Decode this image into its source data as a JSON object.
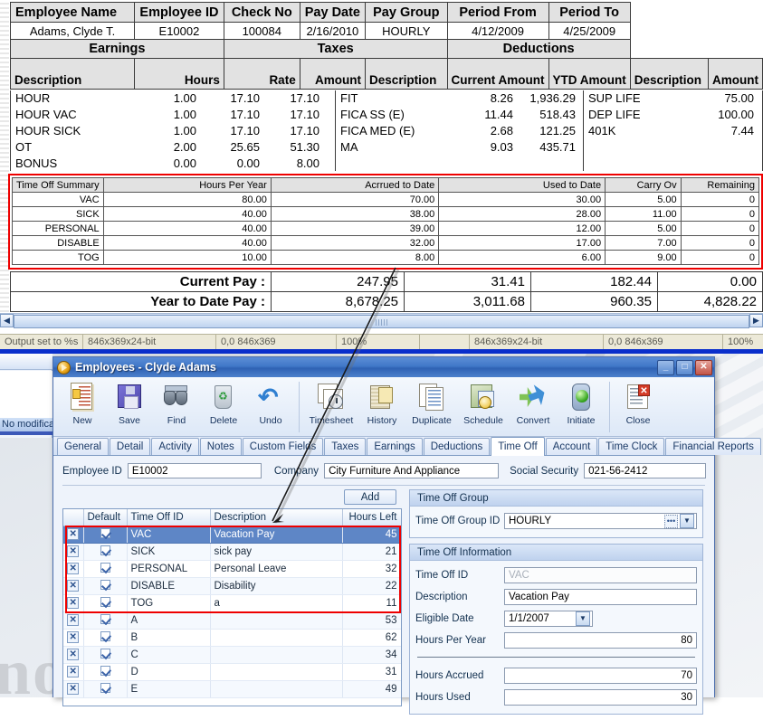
{
  "paystub": {
    "top_headers": [
      "Employee Name",
      "Employee ID",
      "Check No",
      "Pay Date",
      "Pay Group",
      "Period From",
      "Period To"
    ],
    "top_values": [
      "Adams, Clyde T.",
      "E10002",
      "100084",
      "2/16/2010",
      "HOURLY",
      "4/12/2009",
      "4/25/2009"
    ],
    "group_headers": [
      "Earnings",
      "Taxes",
      "Deductions"
    ],
    "earnings_headers": [
      "Description",
      "Hours",
      "Rate",
      "Amount"
    ],
    "taxes_headers": [
      "Description",
      "Current Amount",
      "YTD Amount"
    ],
    "deductions_headers": [
      "Description",
      "Amount"
    ],
    "earnings_rows": [
      {
        "description": "HOUR",
        "hours": "1.00",
        "rate": "17.10",
        "amount": "17.10"
      },
      {
        "description": "HOUR VAC",
        "hours": "1.00",
        "rate": "17.10",
        "amount": "17.10"
      },
      {
        "description": "HOUR SICK",
        "hours": "1.00",
        "rate": "17.10",
        "amount": "17.10"
      },
      {
        "description": "OT",
        "hours": "2.00",
        "rate": "25.65",
        "amount": "51.30"
      },
      {
        "description": "BONUS",
        "hours": "0.00",
        "rate": "0.00",
        "amount": "8.00"
      }
    ],
    "taxes_rows": [
      {
        "description": "FIT",
        "current": "8.26",
        "ytd": "1,936.29"
      },
      {
        "description": "FICA SS (E)",
        "current": "11.44",
        "ytd": "518.43"
      },
      {
        "description": "FICA MED (E)",
        "current": "2.68",
        "ytd": "121.25"
      },
      {
        "description": "MA",
        "current": "9.03",
        "ytd": "435.71"
      }
    ],
    "deductions_rows": [
      {
        "description": "SUP LIFE",
        "amount": "75.00"
      },
      {
        "description": "DEP LIFE",
        "amount": "100.00"
      },
      {
        "description": "401K",
        "amount": "7.44"
      }
    ],
    "time_off_summary": {
      "headers": [
        "Time Off Summary",
        "Hours Per Year",
        "Acrrued to Date",
        "Used to Date",
        "Carry Ov",
        "Remaining"
      ],
      "rows": [
        [
          "VAC",
          "80.00",
          "70.00",
          "30.00",
          "5.00",
          "0"
        ],
        [
          "SICK",
          "40.00",
          "38.00",
          "28.00",
          "11.00",
          "0"
        ],
        [
          "PERSONAL",
          "40.00",
          "39.00",
          "12.00",
          "5.00",
          "0"
        ],
        [
          "DISABLE",
          "40.00",
          "32.00",
          "17.00",
          "7.00",
          "0"
        ],
        [
          "TOG",
          "10.00",
          "8.00",
          "6.00",
          "9.00",
          "0"
        ]
      ]
    },
    "totals": [
      {
        "label": "Current Pay :",
        "c1": "247.95",
        "c2": "31.41",
        "c3": "182.44",
        "c4": "0.00"
      },
      {
        "label": "Year to Date Pay :",
        "c1": "8,678.25",
        "c2": "3,011.68",
        "c3": "960.35",
        "c4": "4,828.22"
      }
    ]
  },
  "statusbar": {
    "cells": [
      "Output set to %s",
      "846x369x24-bit",
      "0,0  846x369",
      "100%",
      "",
      "846x369x24-bit",
      "0,0  846x369",
      "100%"
    ]
  },
  "background": {
    "fragment_text": "No modifica"
  },
  "window": {
    "title": "Employees  -  Clyde Adams",
    "buttons": {
      "minimize": "_",
      "maximize": "□",
      "close": "✕"
    },
    "toolbar": [
      {
        "label": "New",
        "icon": "new-record-icon"
      },
      {
        "label": "Save",
        "icon": "save-floppy-icon"
      },
      {
        "label": "Find",
        "icon": "find-binoculars-icon"
      },
      {
        "label": "Delete",
        "icon": "delete-recycle-icon"
      },
      {
        "label": "Undo",
        "icon": "undo-arrow-icon"
      },
      {
        "label": "Timesheet",
        "icon": "timesheet-clock-icon"
      },
      {
        "label": "History",
        "icon": "history-hourglass-icon"
      },
      {
        "label": "Duplicate",
        "icon": "duplicate-pages-icon"
      },
      {
        "label": "Schedule",
        "icon": "schedule-calendar-icon"
      },
      {
        "label": "Convert",
        "icon": "convert-arrows-icon"
      },
      {
        "label": "Initiate",
        "icon": "initiate-traffic-light-icon"
      },
      {
        "label": "Close",
        "icon": "close-document-icon"
      }
    ],
    "tabs": [
      {
        "label": "General",
        "active": false
      },
      {
        "label": "Detail",
        "active": false
      },
      {
        "label": "Activity",
        "active": false
      },
      {
        "label": "Notes",
        "active": false
      },
      {
        "label": "Custom Fields",
        "active": false
      },
      {
        "label": "Taxes",
        "active": false
      },
      {
        "label": "Earnings",
        "active": false
      },
      {
        "label": "Deductions",
        "active": false
      },
      {
        "label": "Time Off",
        "active": true
      },
      {
        "label": "Account",
        "active": false
      },
      {
        "label": "Time Clock",
        "active": false
      },
      {
        "label": "Financial Reports",
        "active": false
      }
    ],
    "fields": {
      "employee_id_label": "Employee ID",
      "employee_id_value": "E10002",
      "company_label": "Company",
      "company_value": "City Furniture And Appliance",
      "ssn_label": "Social Security",
      "ssn_value": "021-56-2412"
    },
    "add_button": "Add",
    "grid": {
      "headers": [
        "",
        "Default",
        "Time Off ID",
        "Description",
        "Hours Left"
      ],
      "rows": [
        {
          "default": true,
          "id": "VAC",
          "description": "Vacation Pay",
          "hours_left": "45",
          "selected": true
        },
        {
          "default": true,
          "id": "SICK",
          "description": "sick pay",
          "hours_left": "21",
          "selected": false
        },
        {
          "default": true,
          "id": "PERSONAL",
          "description": "Personal Leave",
          "hours_left": "32",
          "selected": false
        },
        {
          "default": true,
          "id": "DISABLE",
          "description": "Disability",
          "hours_left": "22",
          "selected": false
        },
        {
          "default": true,
          "id": "TOG",
          "description": "a",
          "hours_left": "11",
          "selected": false
        },
        {
          "default": true,
          "id": "A",
          "description": "",
          "hours_left": "53",
          "selected": false
        },
        {
          "default": true,
          "id": "B",
          "description": "",
          "hours_left": "62",
          "selected": false
        },
        {
          "default": true,
          "id": "C",
          "description": "",
          "hours_left": "34",
          "selected": false
        },
        {
          "default": true,
          "id": "D",
          "description": "",
          "hours_left": "31",
          "selected": false
        },
        {
          "default": true,
          "id": "E",
          "description": "",
          "hours_left": "49",
          "selected": false
        }
      ],
      "delete_cell_glyph": "✕"
    },
    "time_off_group": {
      "panel_title": "Time Off Group",
      "group_id_label": "Time Off Group ID",
      "group_id_value": "HOURLY",
      "ellipsis_glyph": "•••",
      "caret_glyph": "▼"
    },
    "time_off_information": {
      "panel_title": "Time Off Information",
      "rows": [
        {
          "label": "Time Off ID",
          "value": "VAC",
          "type": "readonly"
        },
        {
          "label": "Description",
          "value": "Vacation Pay",
          "type": "text"
        },
        {
          "label": "Eligible Date",
          "value": "1/1/2007",
          "type": "date"
        },
        {
          "label": "Hours Per Year",
          "value": "80",
          "type": "number"
        },
        {
          "label": "Hours Accrued",
          "value": "70",
          "type": "number"
        },
        {
          "label": "Hours Used",
          "value": "30",
          "type": "number"
        }
      ]
    }
  },
  "colors": {
    "annotation_red": "#ee0000",
    "titlebar_blue": "#2f62b4",
    "selection_blue": "#5e86c6",
    "statusbar_bg": "#ece9d8"
  }
}
